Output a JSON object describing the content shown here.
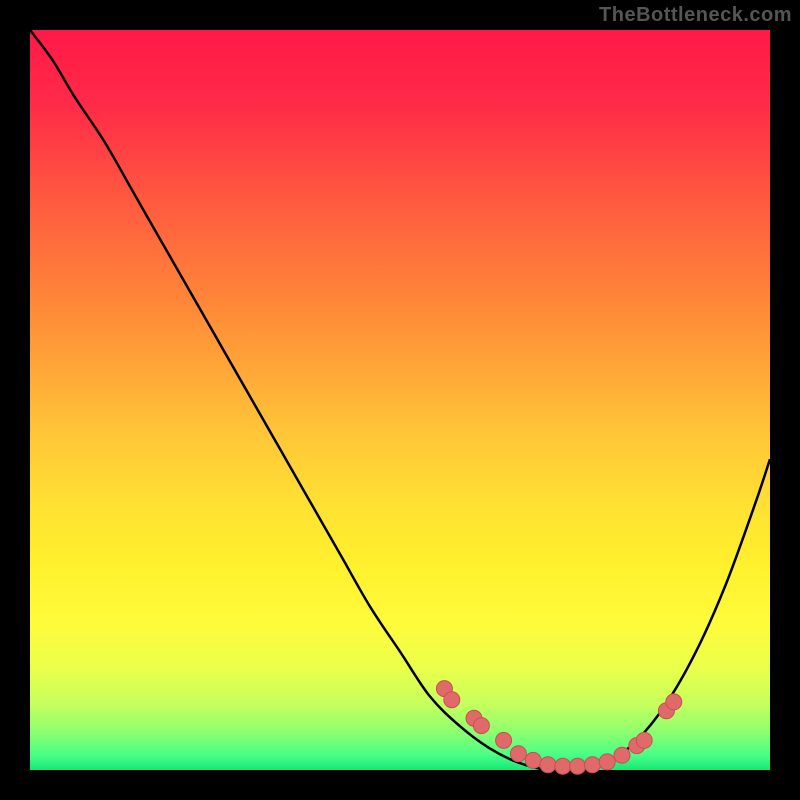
{
  "attribution": "TheBottleneck.com",
  "colors": {
    "frame": "#000000",
    "curve": "#000000",
    "marker_fill": "#e06a6a",
    "marker_stroke": "#c94f4f"
  },
  "chart_data": {
    "type": "line",
    "title": "",
    "xlabel": "",
    "ylabel": "",
    "xlim": [
      0,
      100
    ],
    "ylim": [
      0,
      100
    ],
    "series": [
      {
        "name": "bottleneck-curve",
        "x": [
          0,
          3,
          6,
          10,
          14,
          18,
          22,
          26,
          30,
          34,
          38,
          42,
          46,
          50,
          54,
          58,
          62,
          66,
          70,
          74,
          78,
          82,
          86,
          90,
          94,
          98,
          100
        ],
        "y": [
          100,
          96,
          91,
          85,
          78,
          71,
          64,
          57,
          50,
          43,
          36,
          29,
          22,
          16,
          10,
          6,
          3,
          1,
          0,
          0,
          1,
          4,
          9,
          16,
          25,
          36,
          42
        ]
      }
    ],
    "markers": {
      "name": "highlight-points",
      "x": [
        56,
        57,
        60,
        61,
        64,
        66,
        68,
        70,
        72,
        74,
        76,
        78,
        80,
        82,
        83,
        86,
        87
      ],
      "y": [
        11,
        9.5,
        7,
        6,
        4,
        2.2,
        1.3,
        0.7,
        0.5,
        0.5,
        0.7,
        1.1,
        2.0,
        3.3,
        4.0,
        8.0,
        9.2
      ]
    }
  }
}
